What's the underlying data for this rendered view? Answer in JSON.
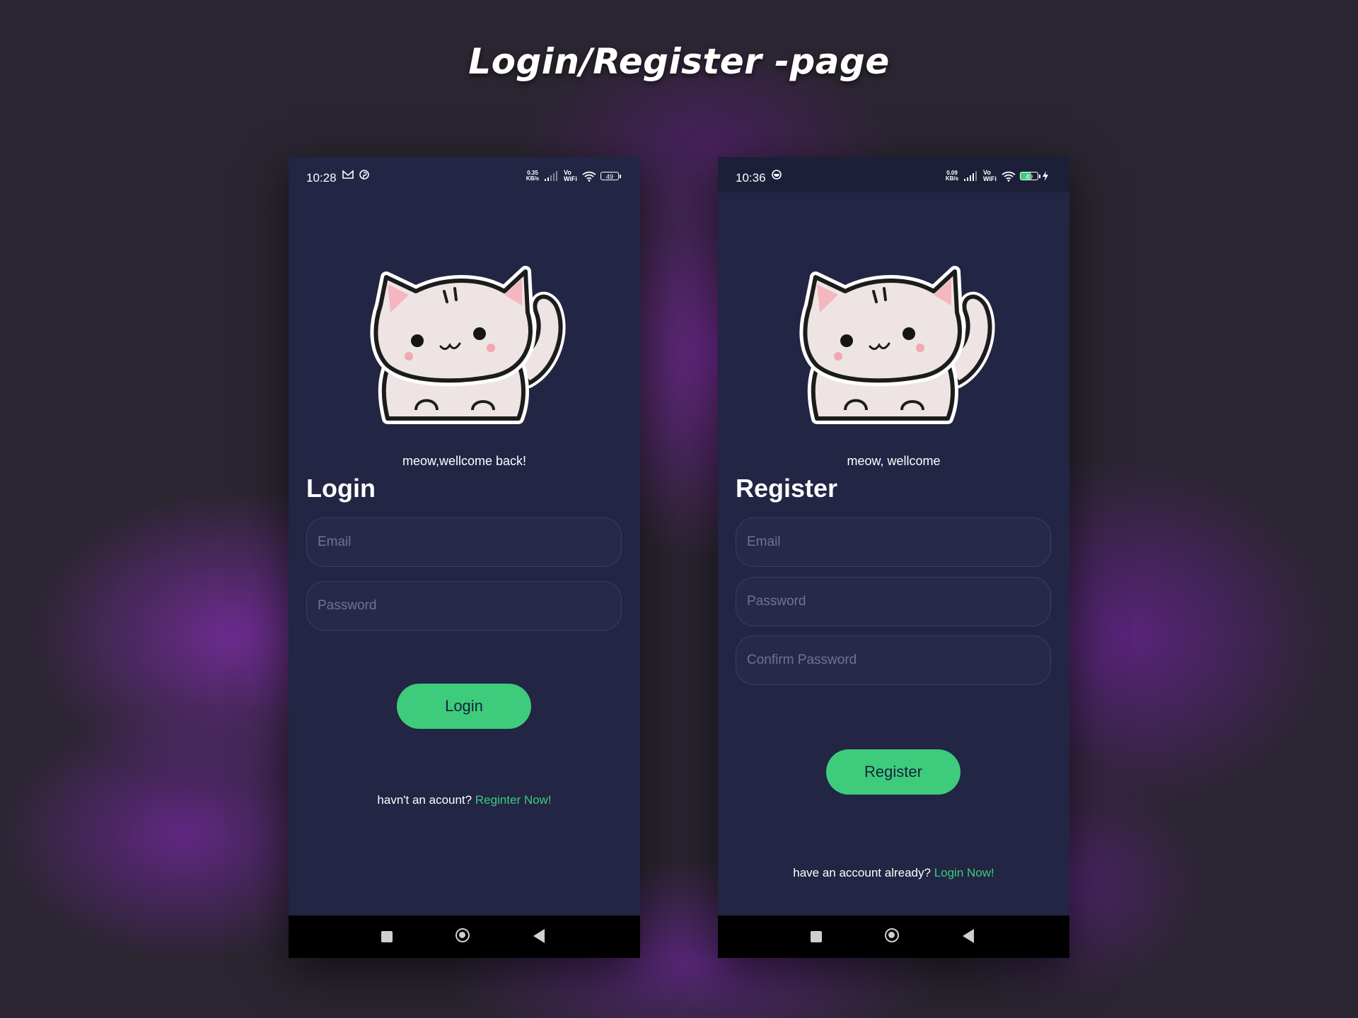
{
  "headline": "Login/Register -page",
  "login_screen": {
    "status": {
      "time": "10:28",
      "net_speed": "0.35 KB/s",
      "vowifi": "Vo WiFi",
      "battery": "49"
    },
    "welcome": "meow,wellcome back!",
    "title": "Login",
    "fields": {
      "email_placeholder": "Email",
      "password_placeholder": "Password"
    },
    "button_label": "Login",
    "footer_prompt": "havn't an acount?",
    "footer_link": "Reginter Now!"
  },
  "register_screen": {
    "status": {
      "time": "10:36",
      "net_speed": "0.09 KB/s",
      "vowifi": "Vo WiFi",
      "battery": "49"
    },
    "welcome": "meow, wellcome",
    "title": "Register",
    "fields": {
      "email_placeholder": "Email",
      "password_placeholder": "Password",
      "confirm_password_placeholder": "Confirm Password"
    },
    "button_label": "Register",
    "footer_prompt": "have an account already?",
    "footer_link": "Login Now!"
  },
  "icons": [
    "gmail-icon",
    "pinterest-icon",
    "signal-icon",
    "wifi-icon",
    "battery-icon",
    "charging-icon",
    "recents-icon",
    "home-icon",
    "back-icon",
    "cat-mascot"
  ],
  "colors": {
    "screen_bg": "#222544",
    "accent": "#3ecb7c",
    "field_border": "#3a3e62",
    "placeholder": "#6f7394"
  }
}
